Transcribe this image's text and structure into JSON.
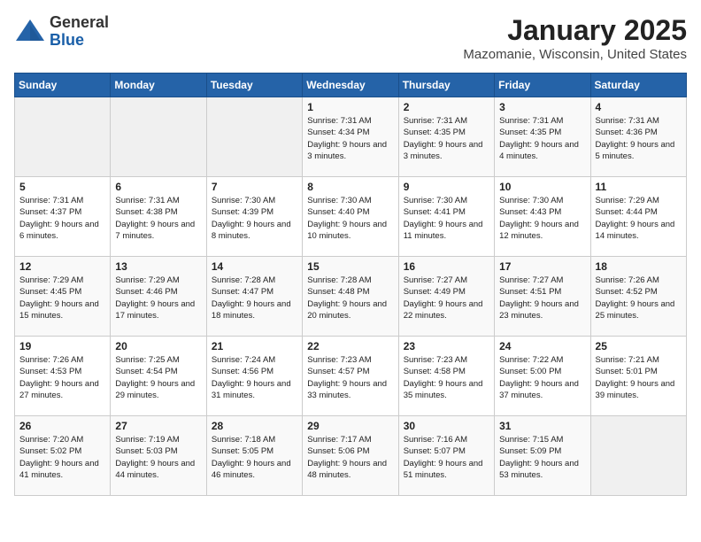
{
  "header": {
    "logo_general": "General",
    "logo_blue": "Blue",
    "month_title": "January 2025",
    "location": "Mazomanie, Wisconsin, United States"
  },
  "days_of_week": [
    "Sunday",
    "Monday",
    "Tuesday",
    "Wednesday",
    "Thursday",
    "Friday",
    "Saturday"
  ],
  "weeks": [
    [
      {
        "day": "",
        "empty": true
      },
      {
        "day": "",
        "empty": true
      },
      {
        "day": "",
        "empty": true
      },
      {
        "day": "1",
        "sunrise": "Sunrise: 7:31 AM",
        "sunset": "Sunset: 4:34 PM",
        "daylight": "Daylight: 9 hours and 3 minutes."
      },
      {
        "day": "2",
        "sunrise": "Sunrise: 7:31 AM",
        "sunset": "Sunset: 4:35 PM",
        "daylight": "Daylight: 9 hours and 3 minutes."
      },
      {
        "day": "3",
        "sunrise": "Sunrise: 7:31 AM",
        "sunset": "Sunset: 4:35 PM",
        "daylight": "Daylight: 9 hours and 4 minutes."
      },
      {
        "day": "4",
        "sunrise": "Sunrise: 7:31 AM",
        "sunset": "Sunset: 4:36 PM",
        "daylight": "Daylight: 9 hours and 5 minutes."
      }
    ],
    [
      {
        "day": "5",
        "sunrise": "Sunrise: 7:31 AM",
        "sunset": "Sunset: 4:37 PM",
        "daylight": "Daylight: 9 hours and 6 minutes."
      },
      {
        "day": "6",
        "sunrise": "Sunrise: 7:31 AM",
        "sunset": "Sunset: 4:38 PM",
        "daylight": "Daylight: 9 hours and 7 minutes."
      },
      {
        "day": "7",
        "sunrise": "Sunrise: 7:30 AM",
        "sunset": "Sunset: 4:39 PM",
        "daylight": "Daylight: 9 hours and 8 minutes."
      },
      {
        "day": "8",
        "sunrise": "Sunrise: 7:30 AM",
        "sunset": "Sunset: 4:40 PM",
        "daylight": "Daylight: 9 hours and 10 minutes."
      },
      {
        "day": "9",
        "sunrise": "Sunrise: 7:30 AM",
        "sunset": "Sunset: 4:41 PM",
        "daylight": "Daylight: 9 hours and 11 minutes."
      },
      {
        "day": "10",
        "sunrise": "Sunrise: 7:30 AM",
        "sunset": "Sunset: 4:43 PM",
        "daylight": "Daylight: 9 hours and 12 minutes."
      },
      {
        "day": "11",
        "sunrise": "Sunrise: 7:29 AM",
        "sunset": "Sunset: 4:44 PM",
        "daylight": "Daylight: 9 hours and 14 minutes."
      }
    ],
    [
      {
        "day": "12",
        "sunrise": "Sunrise: 7:29 AM",
        "sunset": "Sunset: 4:45 PM",
        "daylight": "Daylight: 9 hours and 15 minutes."
      },
      {
        "day": "13",
        "sunrise": "Sunrise: 7:29 AM",
        "sunset": "Sunset: 4:46 PM",
        "daylight": "Daylight: 9 hours and 17 minutes."
      },
      {
        "day": "14",
        "sunrise": "Sunrise: 7:28 AM",
        "sunset": "Sunset: 4:47 PM",
        "daylight": "Daylight: 9 hours and 18 minutes."
      },
      {
        "day": "15",
        "sunrise": "Sunrise: 7:28 AM",
        "sunset": "Sunset: 4:48 PM",
        "daylight": "Daylight: 9 hours and 20 minutes."
      },
      {
        "day": "16",
        "sunrise": "Sunrise: 7:27 AM",
        "sunset": "Sunset: 4:49 PM",
        "daylight": "Daylight: 9 hours and 22 minutes."
      },
      {
        "day": "17",
        "sunrise": "Sunrise: 7:27 AM",
        "sunset": "Sunset: 4:51 PM",
        "daylight": "Daylight: 9 hours and 23 minutes."
      },
      {
        "day": "18",
        "sunrise": "Sunrise: 7:26 AM",
        "sunset": "Sunset: 4:52 PM",
        "daylight": "Daylight: 9 hours and 25 minutes."
      }
    ],
    [
      {
        "day": "19",
        "sunrise": "Sunrise: 7:26 AM",
        "sunset": "Sunset: 4:53 PM",
        "daylight": "Daylight: 9 hours and 27 minutes."
      },
      {
        "day": "20",
        "sunrise": "Sunrise: 7:25 AM",
        "sunset": "Sunset: 4:54 PM",
        "daylight": "Daylight: 9 hours and 29 minutes."
      },
      {
        "day": "21",
        "sunrise": "Sunrise: 7:24 AM",
        "sunset": "Sunset: 4:56 PM",
        "daylight": "Daylight: 9 hours and 31 minutes."
      },
      {
        "day": "22",
        "sunrise": "Sunrise: 7:23 AM",
        "sunset": "Sunset: 4:57 PM",
        "daylight": "Daylight: 9 hours and 33 minutes."
      },
      {
        "day": "23",
        "sunrise": "Sunrise: 7:23 AM",
        "sunset": "Sunset: 4:58 PM",
        "daylight": "Daylight: 9 hours and 35 minutes."
      },
      {
        "day": "24",
        "sunrise": "Sunrise: 7:22 AM",
        "sunset": "Sunset: 5:00 PM",
        "daylight": "Daylight: 9 hours and 37 minutes."
      },
      {
        "day": "25",
        "sunrise": "Sunrise: 7:21 AM",
        "sunset": "Sunset: 5:01 PM",
        "daylight": "Daylight: 9 hours and 39 minutes."
      }
    ],
    [
      {
        "day": "26",
        "sunrise": "Sunrise: 7:20 AM",
        "sunset": "Sunset: 5:02 PM",
        "daylight": "Daylight: 9 hours and 41 minutes."
      },
      {
        "day": "27",
        "sunrise": "Sunrise: 7:19 AM",
        "sunset": "Sunset: 5:03 PM",
        "daylight": "Daylight: 9 hours and 44 minutes."
      },
      {
        "day": "28",
        "sunrise": "Sunrise: 7:18 AM",
        "sunset": "Sunset: 5:05 PM",
        "daylight": "Daylight: 9 hours and 46 minutes."
      },
      {
        "day": "29",
        "sunrise": "Sunrise: 7:17 AM",
        "sunset": "Sunset: 5:06 PM",
        "daylight": "Daylight: 9 hours and 48 minutes."
      },
      {
        "day": "30",
        "sunrise": "Sunrise: 7:16 AM",
        "sunset": "Sunset: 5:07 PM",
        "daylight": "Daylight: 9 hours and 51 minutes."
      },
      {
        "day": "31",
        "sunrise": "Sunrise: 7:15 AM",
        "sunset": "Sunset: 5:09 PM",
        "daylight": "Daylight: 9 hours and 53 minutes."
      },
      {
        "day": "",
        "empty": true
      }
    ]
  ]
}
